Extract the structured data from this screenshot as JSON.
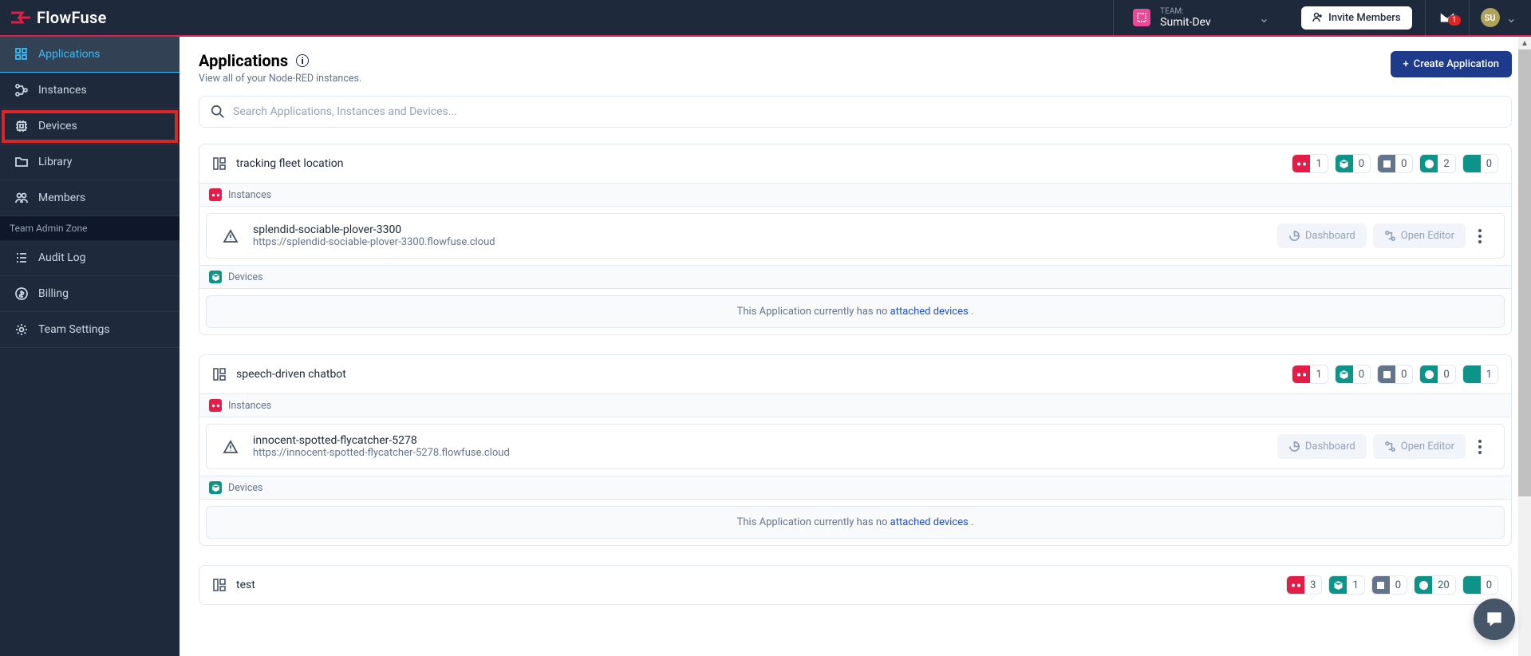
{
  "brand": {
    "name": "FlowFuse"
  },
  "header": {
    "team_label": "TEAM:",
    "team_name": "Sumit-Dev",
    "invite_label": "Invite Members",
    "mail_badge": "1",
    "avatar_initials": "SU"
  },
  "sidebar": {
    "main": [
      {
        "id": "applications",
        "label": "Applications"
      },
      {
        "id": "instances",
        "label": "Instances"
      },
      {
        "id": "devices",
        "label": "Devices"
      },
      {
        "id": "library",
        "label": "Library"
      },
      {
        "id": "members",
        "label": "Members"
      }
    ],
    "admin_header": "Team Admin Zone",
    "admin": [
      {
        "id": "audit-log",
        "label": "Audit Log"
      },
      {
        "id": "billing",
        "label": "Billing"
      },
      {
        "id": "team-settings",
        "label": "Team Settings"
      }
    ]
  },
  "page": {
    "title": "Applications",
    "subtitle": "View all of your Node-RED instances.",
    "create_label": "Create Application",
    "search_placeholder": "Search Applications, Instances and Devices..."
  },
  "sections": {
    "instances_label": "Instances",
    "devices_label": "Devices",
    "dashboard_label": "Dashboard",
    "open_editor_label": "Open Editor"
  },
  "empty_devices": {
    "pre": "This Application currently has no ",
    "link": "attached devices",
    "post": " ."
  },
  "apps": [
    {
      "name": "tracking fleet location",
      "counts": {
        "red": "1",
        "teal": "0",
        "gray": "0",
        "sky": "2",
        "bar": "0"
      },
      "instances": [
        {
          "name": "splendid-sociable-plover-3300",
          "url": "https://splendid-sociable-plover-3300.flowfuse.cloud"
        }
      ],
      "devices_empty": true
    },
    {
      "name": "speech-driven chatbot",
      "counts": {
        "red": "1",
        "teal": "0",
        "gray": "0",
        "sky": "0",
        "bar": "1"
      },
      "instances": [
        {
          "name": "innocent-spotted-flycatcher-5278",
          "url": "https://innocent-spotted-flycatcher-5278.flowfuse.cloud"
        }
      ],
      "devices_empty": true
    },
    {
      "name": "test",
      "counts": {
        "red": "3",
        "teal": "1",
        "gray": "0",
        "sky": "20",
        "bar": "0"
      },
      "instances": [],
      "devices_empty": false
    }
  ]
}
